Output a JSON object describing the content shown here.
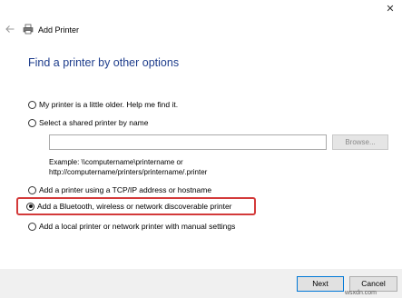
{
  "window": {
    "title": "Add Printer",
    "close_glyph": "✕"
  },
  "page_title": "Find a printer by other options",
  "options": [
    {
      "label": "My printer is a little older. Help me find it.",
      "selected": false
    },
    {
      "label": "Select a shared printer by name",
      "selected": false
    },
    {
      "label": "Add a printer using a TCP/IP address or hostname",
      "selected": false
    },
    {
      "label": "Add a Bluetooth, wireless or network discoverable printer",
      "selected": true
    },
    {
      "label": "Add a local printer or network printer with manual settings",
      "selected": false
    }
  ],
  "shared_printer": {
    "input_value": "",
    "browse_label": "Browse...",
    "example_line1": "Example: \\\\computername\\printername or",
    "example_line2": "http://computername/printers/printername/.printer"
  },
  "footer": {
    "next_label": "Next",
    "cancel_label": "Cancel"
  },
  "watermark": "wsxdn.com",
  "colors": {
    "title_blue": "#1e3d8c",
    "highlight_red": "#d33a3a",
    "footer_bg": "#f0f0f0",
    "default_button_border": "#0078d7"
  },
  "icons": {
    "back": "back-arrow-icon",
    "printer": "printer-icon",
    "close": "close-icon"
  }
}
